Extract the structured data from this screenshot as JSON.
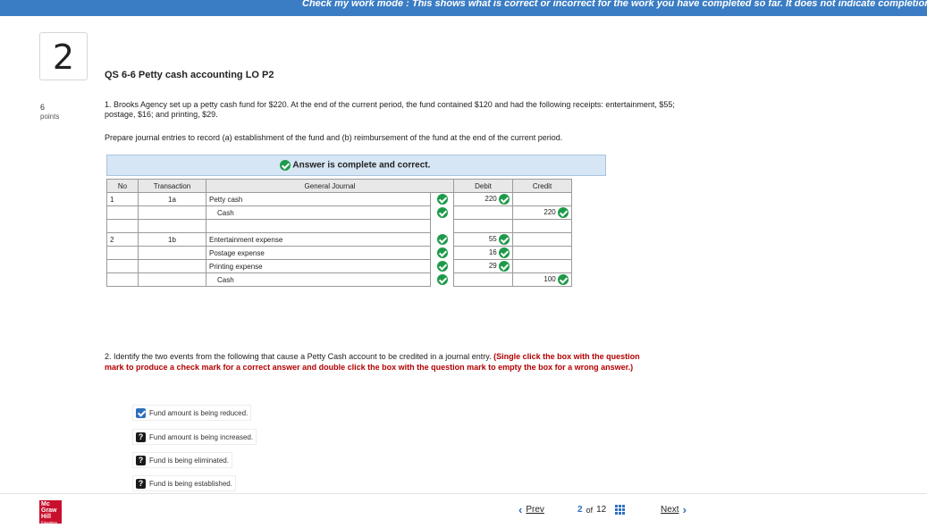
{
  "topbar": {
    "text": "Check my work mode : This shows what is correct or incorrect for the work you have completed so far. It does not indicate completion."
  },
  "question": {
    "number": "2",
    "points_value": "6",
    "points_label": "points",
    "title": "QS 6-6 Petty cash accounting LO P2",
    "part1_text": "1. Brooks Agency set up a petty cash fund for $220. At the end of the current period, the fund contained $120 and had the following receipts: entertainment, $55; postage, $16; and printing, $29.",
    "part1_instruction": "Prepare journal entries to record (a) establishment of the fund and (b) reimbursement of the fund at the end of the current period."
  },
  "banner": {
    "text": "Answer is complete and correct."
  },
  "journal": {
    "headers": {
      "no": "No",
      "transaction": "Transaction",
      "general_journal": "General Journal",
      "debit": "Debit",
      "credit": "Credit"
    },
    "rows": [
      {
        "no": "1",
        "transaction": "1a",
        "account": "Petty cash",
        "debit": "220",
        "credit": ""
      },
      {
        "no": "",
        "transaction": "",
        "account": "Cash",
        "debit": "",
        "credit": "220"
      },
      {
        "no": "2",
        "transaction": "1b",
        "account": "Entertainment expense",
        "debit": "55",
        "credit": ""
      },
      {
        "no": "",
        "transaction": "",
        "account": "Postage expense",
        "debit": "16",
        "credit": ""
      },
      {
        "no": "",
        "transaction": "",
        "account": "Printing expense",
        "debit": "29",
        "credit": ""
      },
      {
        "no": "",
        "transaction": "",
        "account": "Cash",
        "debit": "",
        "credit": "100"
      }
    ]
  },
  "part2": {
    "text": "2. Identify the two events from the following that cause a Petty Cash account to be credited in a journal entry.",
    "hint": "(Single click the box with the question mark to produce a check mark for a correct answer and double click the box with the question mark to empty the box for a wrong answer.)",
    "options": [
      {
        "label": "Fund amount is being reduced.",
        "state": "checked"
      },
      {
        "label": "Fund amount is being increased.",
        "state": "question"
      },
      {
        "label": "Fund is being eliminated.",
        "state": "question"
      },
      {
        "label": "Fund is being established.",
        "state": "question"
      }
    ]
  },
  "footer": {
    "logo_line1": "Mc",
    "logo_line2": "Graw",
    "logo_line3": "Hill",
    "logo_line4": "Education",
    "prev_label": "Prev",
    "current_page": "2",
    "of_label": "of",
    "total_pages": "12",
    "next_label": "Next"
  },
  "colors": {
    "topbar": "#3b7dc4",
    "banner_bg": "#d7e6f4",
    "correct_green": "#1e9a4a",
    "hint_red": "#b30000",
    "link_blue": "#2e6fbd",
    "brand_red": "#c8102e"
  }
}
